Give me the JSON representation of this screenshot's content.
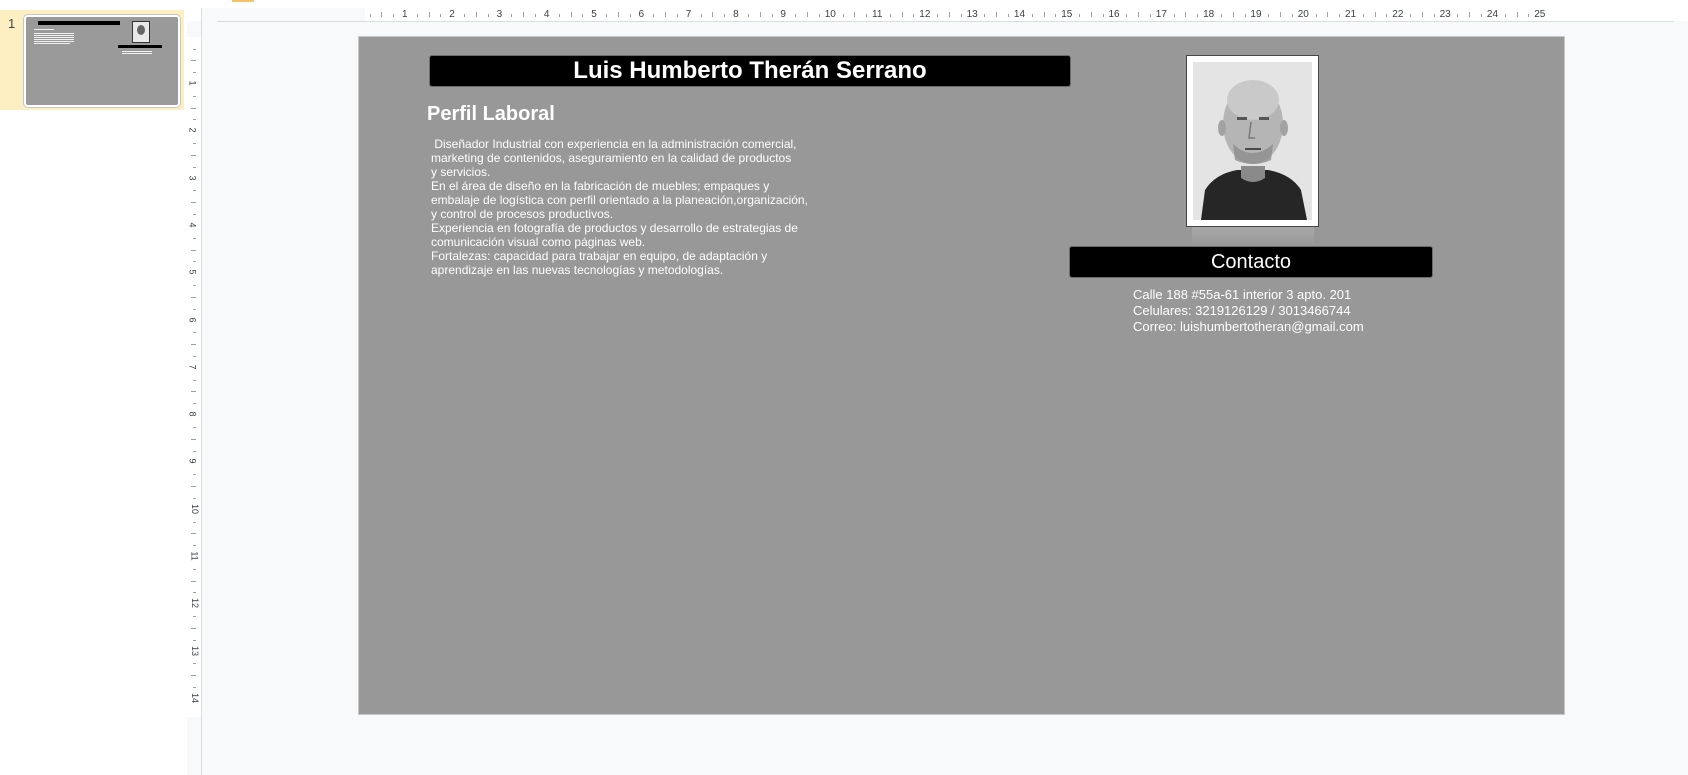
{
  "filmstrip": {
    "slide_number": "1"
  },
  "ruler": {
    "h_numbers": [
      "1",
      "2",
      "3",
      "4",
      "5",
      "6",
      "7",
      "8",
      "9",
      "10",
      "11",
      "12",
      "13",
      "14",
      "15",
      "16",
      "17",
      "18",
      "19",
      "20",
      "21",
      "22",
      "23",
      "24",
      "25"
    ],
    "v_numbers": [
      "1",
      "2",
      "3",
      "4",
      "5",
      "6",
      "7",
      "8",
      "9",
      "10",
      "11",
      "12",
      "13",
      "14"
    ]
  },
  "slide": {
    "name": "Luis Humberto Therán Serrano",
    "perfil_heading": "Perfil Laboral",
    "perfil_lines": [
      " Diseñador Industrial con experiencia en la administración comercial,",
      "marketing de contenidos, aseguramiento en la calidad de productos",
      "y servicios.",
      "En el área de diseño en la fabricación de muebles; empaques y",
      "embalaje de logística con perfil orientado a la planeación,organización,",
      "y control de procesos productivos.",
      "Experiencia en fotografía de productos y desarrollo de estrategias de",
      "comunicación visual como páginas web.",
      "Fortalezas: capacidad para trabajar en equipo, de adaptación y",
      "aprendizaje en las nuevas tecnologías y metodologías."
    ],
    "contact_heading": "Contacto",
    "address": "Calle 188 #55a-61 interior 3 apto. 201",
    "phones": "Celulares: 3219126129 / 3013466744",
    "email": "Correo: luishumbertotheran@gmail.com"
  },
  "colors": {
    "slide_bg": "#989898",
    "bar_bg": "#000000",
    "selected_thumb": "#feefc3"
  }
}
